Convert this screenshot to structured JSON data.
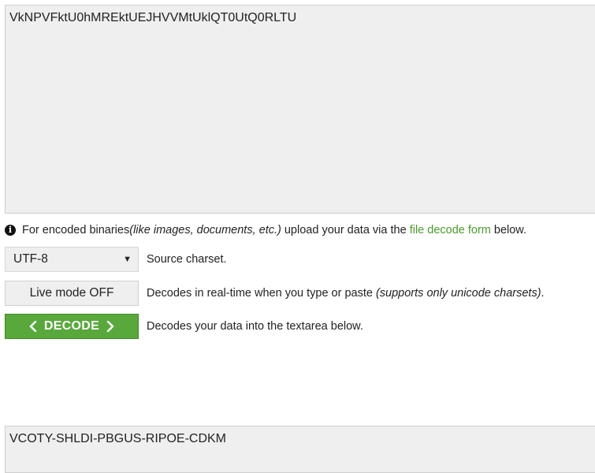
{
  "input": {
    "value": "VkNPVFktU0hMREktUEJHVVMtUklQT0UtQ0RLTU"
  },
  "info": {
    "text_before": "For encoded binaries ",
    "text_italic": "(like images, documents, etc.)",
    "text_middle": " upload your data via the ",
    "link_text": "file decode form",
    "text_after": " below."
  },
  "charset": {
    "selected": "UTF-8",
    "description": "Source charset."
  },
  "live_mode": {
    "label": "Live mode OFF",
    "description": "Decodes in real-time when you type or paste ",
    "description_italic": "(supports only unicode charsets)",
    "description_end": "."
  },
  "decode": {
    "label": "DECODE",
    "description": "Decodes your data into the textarea below.",
    "color": "#58a83b"
  },
  "output": {
    "value": "VCOTY-SHLDI-PBGUS-RIPOE-CDKM"
  },
  "icons": {
    "info": "info-icon",
    "dropdown": "chevron-down-icon",
    "decode_left": "chevron-left-icon",
    "decode_right": "chevron-right-icon"
  }
}
